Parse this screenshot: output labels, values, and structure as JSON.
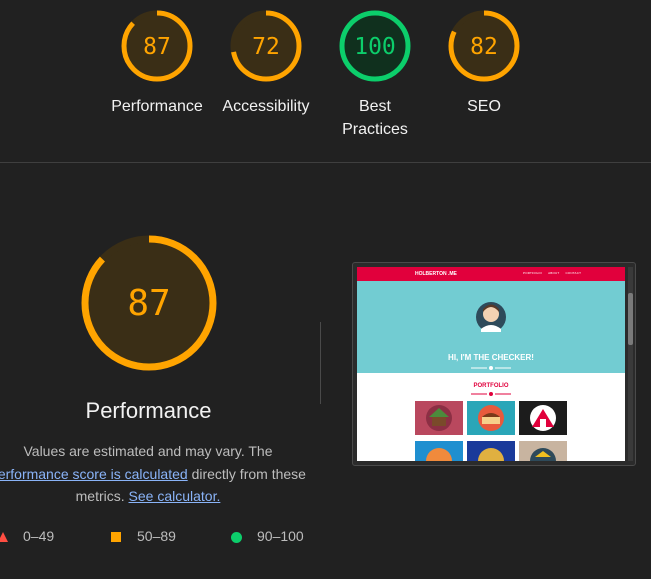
{
  "summary_gauges": [
    {
      "score": "87",
      "label": "Performance",
      "color": "#ffa400",
      "fraction": 0.87
    },
    {
      "score": "72",
      "label": "Accessibility",
      "color": "#ffa400",
      "fraction": 0.72
    },
    {
      "score": "100",
      "label": "Best Practices",
      "color": "#0cce6b",
      "fraction": 1.0
    },
    {
      "score": "82",
      "label": "SEO",
      "color": "#ffa400",
      "fraction": 0.82
    }
  ],
  "performance": {
    "score": "87",
    "fraction": 0.87,
    "color": "#ffa400",
    "title": "Performance",
    "desc_1": "Values are estimated and may vary. The",
    "desc_link": "performance score is calculated",
    "desc_2": " directly from these",
    "desc_3": "metrics. ",
    "calc_link": "See calculator."
  },
  "legend": [
    {
      "range": "0–49",
      "icon": "fail-triangle-icon",
      "color": "#ff4e42"
    },
    {
      "range": "50–89",
      "icon": "average-square-icon",
      "color": "#ffa400"
    },
    {
      "range": "90–100",
      "icon": "pass-circle-icon",
      "color": "#0cce6b"
    }
  ],
  "thumbnail": {
    "brand": "HOLBERTON .ME",
    "nav_links": [
      "PORTFOLIO",
      "ABOUT",
      "CONTACT"
    ],
    "hero_text": "HI, I'M THE CHECKER!",
    "section_title": "PORTFOLIO",
    "colors": {
      "nav": "#e1003c",
      "hero": "#72ccd2"
    }
  },
  "colors": {
    "background": "#212121",
    "pass": "#0cce6b",
    "average": "#ffa400",
    "fail": "#ff4e42",
    "link": "#8ab4f8"
  }
}
